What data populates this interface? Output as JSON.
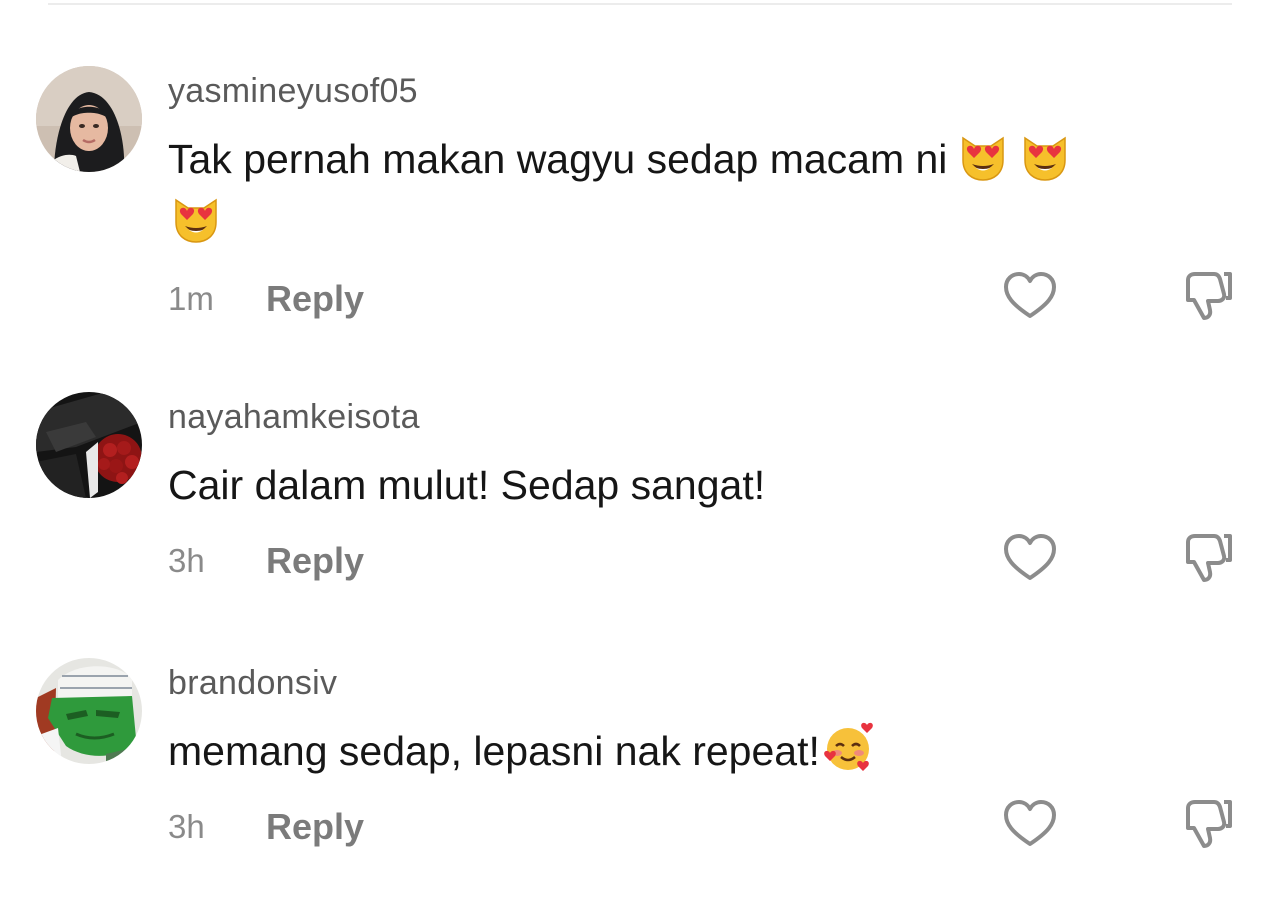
{
  "reply_label": "Reply",
  "comments": [
    {
      "username": "yasmineyusof05",
      "text": "Tak pernah makan wagyu sedap macam ni",
      "emojis_inline": [
        "smiling-cat-heart-eyes",
        "smiling-cat-heart-eyes"
      ],
      "emojis_next_line": [
        "smiling-cat-heart-eyes"
      ],
      "time": "1m",
      "avatar": "avatar-woman-hijab"
    },
    {
      "username": "nayahamkeisota",
      "text": "Cair dalam mulut! Sedap sangat!",
      "emojis_inline": [],
      "emojis_next_line": [],
      "time": "3h",
      "avatar": "avatar-car-interior-roses"
    },
    {
      "username": "brandonsiv",
      "text": "memang sedap, lepasni nak repeat!",
      "emojis_inline": [
        "smiling-face-with-hearts"
      ],
      "emojis_next_line": [],
      "time": "3h",
      "avatar": "avatar-green-character"
    }
  ],
  "icons": {
    "like": "heart-outline-icon",
    "dislike": "thumbs-down-outline-icon"
  },
  "colors": {
    "username": "#5a5a5a",
    "text": "#161616",
    "meta": "#8a8a8a",
    "reply": "#7b7b7b",
    "icon_stroke": "#8c8c8c"
  }
}
